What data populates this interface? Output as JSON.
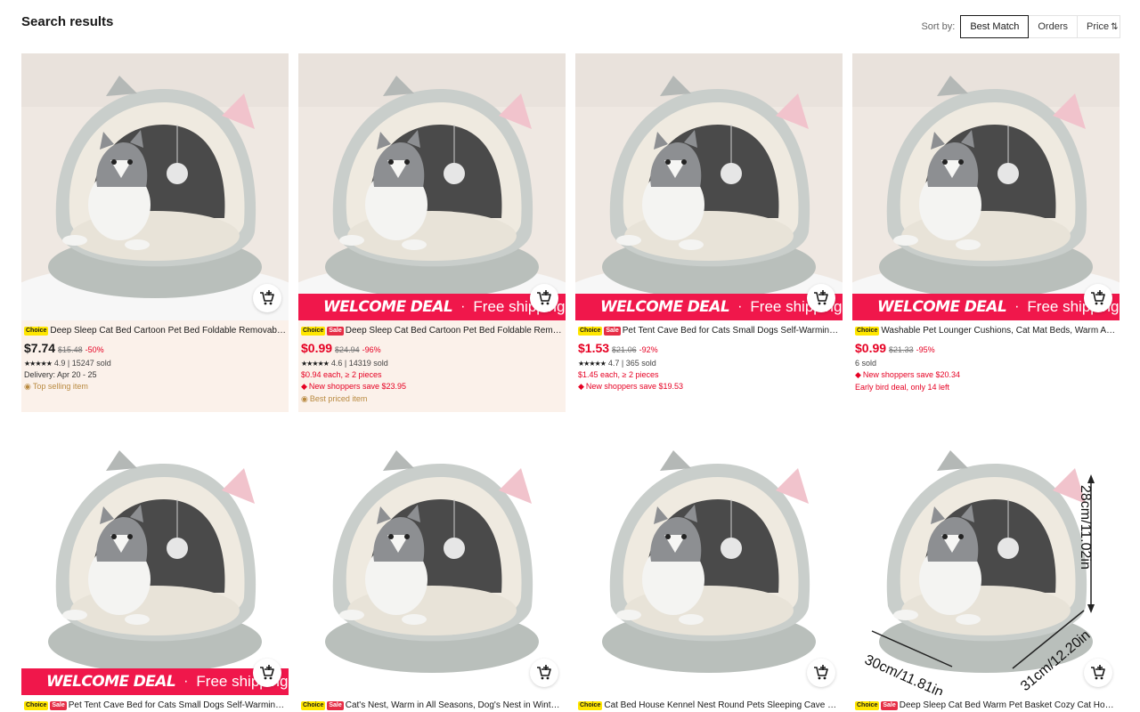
{
  "header": {
    "title": "Search results",
    "sort_label": "Sort by:",
    "sort_options": [
      "Best Match",
      "Orders",
      "Price"
    ],
    "sort_active": "Best Match",
    "price_sort_icon": "sort-arrows-icon"
  },
  "deal_banner": {
    "title": "WELCOME DEAL",
    "separator": "·",
    "subtitle": "Free shipping"
  },
  "products": [
    {
      "badges": [
        "Choice"
      ],
      "title": "Deep Sleep Cat Bed Cartoon Pet Bed Foldable Removable Washable",
      "price": "$7.74",
      "original_price": "$15.48",
      "discount": "-50%",
      "rating": "4.9",
      "sold": "15247 sold",
      "lines": [
        {
          "text": "Delivery: Apr 20 - 25",
          "style": "dark",
          "icon": ""
        },
        {
          "text": "Top selling item",
          "style": "gold",
          "icon": "flame-icon"
        }
      ],
      "welcome_deal": false
    },
    {
      "badges": [
        "Choice",
        "Sale"
      ],
      "title": "Deep Sleep Cat Bed Cartoon Pet Bed Foldable Removable Washable",
      "price": "$0.99",
      "original_price": "$24.94",
      "discount": "-96%",
      "rating": "4.6",
      "sold": "14319 sold",
      "lines": [
        {
          "text": "$0.94 each, ≥ 2 pieces",
          "style": "red",
          "icon": ""
        },
        {
          "text": "New shoppers save $23.95",
          "style": "red",
          "icon": "tag-icon"
        },
        {
          "text": "Best priced item",
          "style": "gold",
          "icon": "flame-icon"
        }
      ],
      "welcome_deal": true
    },
    {
      "badges": [
        "Choice",
        "Sale"
      ],
      "title": "Pet Tent Cave Bed for Cats Small Dogs Self-Warming Cat Tent Bed",
      "price": "$1.53",
      "original_price": "$21.06",
      "discount": "-92%",
      "rating": "4.7",
      "sold": "365 sold",
      "lines": [
        {
          "text": "$1.45 each, ≥ 2 pieces",
          "style": "red",
          "icon": ""
        },
        {
          "text": "New shoppers save $19.53",
          "style": "red",
          "icon": "tag-icon"
        }
      ],
      "welcome_deal": true
    },
    {
      "badges": [
        "Choice"
      ],
      "title": "Washable Pet Lounger Cushions, Cat Mat Beds, Warm And Soft",
      "price": "$0.99",
      "original_price": "$21.33",
      "discount": "-95%",
      "rating": "",
      "sold": "6 sold",
      "lines": [
        {
          "text": "New shoppers save $20.34",
          "style": "red",
          "icon": "tag-icon"
        },
        {
          "text": "Early bird deal, only 14 left",
          "style": "red",
          "icon": ""
        }
      ],
      "welcome_deal": true
    },
    {
      "badges": [
        "Choice",
        "Sale"
      ],
      "title": "Pet Tent Cave Bed for Cats Small Dogs Self-Warming Cat Tent Bed",
      "welcome_deal": true
    },
    {
      "badges": [
        "Choice",
        "Sale"
      ],
      "title": "Cat's Nest, Warm in All Seasons, Dog's Nest in Winter, Enclosed",
      "welcome_deal": false
    },
    {
      "badges": [
        "Choice"
      ],
      "title": "Cat Bed House Kennel Nest Round Pets Sleeping Cave Kitten Bed",
      "welcome_deal": false
    },
    {
      "badges": [
        "Choice",
        "Sale"
      ],
      "title": "Deep Sleep Cat Bed Warm Pet Basket Cozy Cat House Kitten",
      "welcome_deal": false,
      "dimensions": [
        "28cm/11.02in",
        "30cm/11.81in",
        "31cm/12.20in"
      ]
    }
  ],
  "icons": {
    "cart": "add-to-cart-icon",
    "star": "star-icon"
  }
}
